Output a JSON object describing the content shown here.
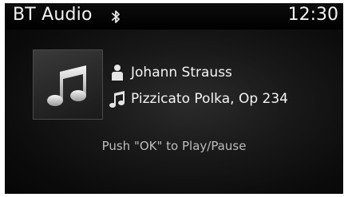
{
  "status": {
    "title": "BT Audio",
    "time": "12:30",
    "connection_icon": "bluetooth-icon"
  },
  "now_playing": {
    "album_art_icon": "music-note-icon",
    "artist": "Johann Strauss",
    "artist_icon": "person-icon",
    "track": "Pizzicato Polka, Op 234",
    "track_icon": "music-note-icon"
  },
  "hint": "Push \"OK\" to Play/Pause",
  "colors": {
    "background": "#0b0b0b",
    "text": "#f4f4f4",
    "hint_text": "#bdbdbd"
  }
}
